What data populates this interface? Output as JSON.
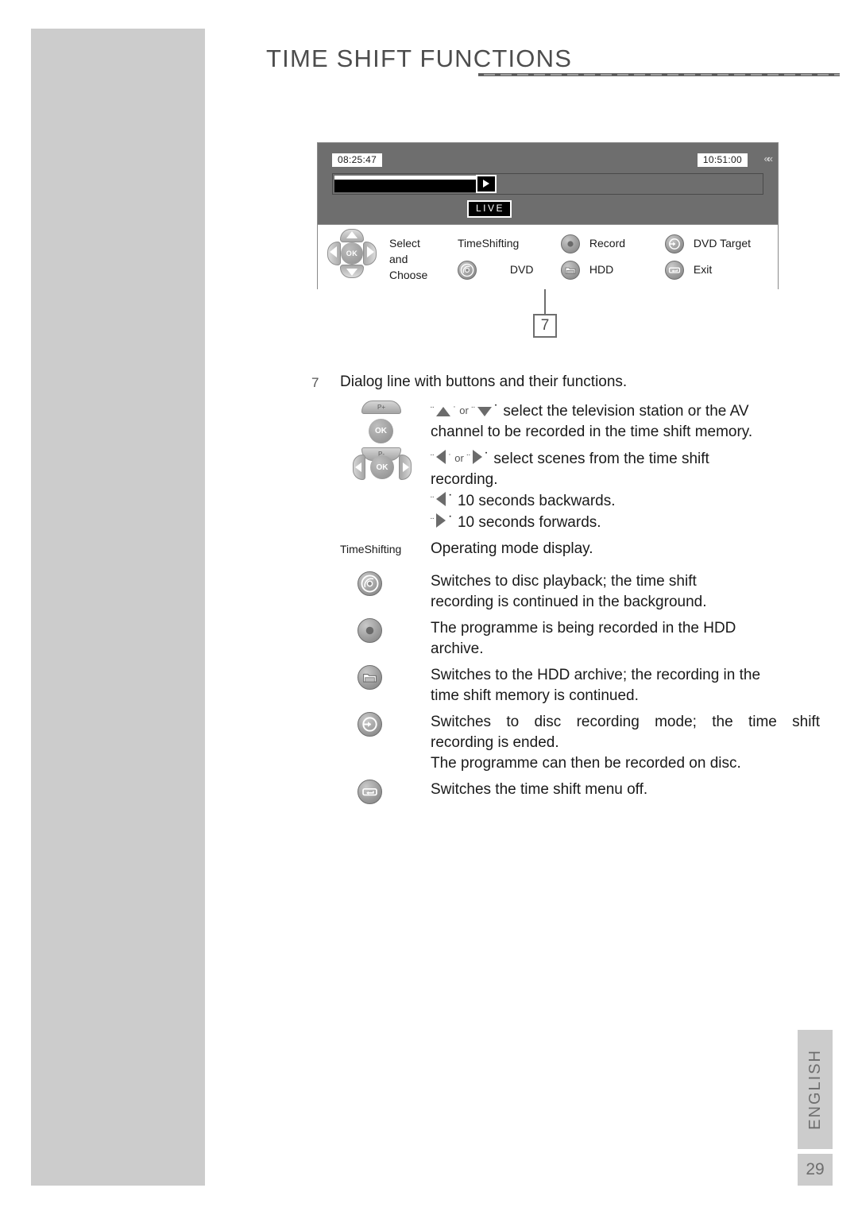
{
  "header": {
    "title": "TIME SHIFT FUNCTIONS",
    "rule": "dashed-rule"
  },
  "osd": {
    "time_start": "08:25:47",
    "time_end": "10:51:00",
    "chevrons": "««",
    "live_badge": "LIVE",
    "progress_percent": 32,
    "dpad": {
      "ok_label": "OK"
    },
    "dialog": {
      "select_line1": "Select",
      "select_line2": "and",
      "select_line3": "Choose",
      "mode_label": "TimeShifting",
      "dvd_label": "DVD",
      "record_label": "Record",
      "hdd_label": "HDD",
      "dvd_target_label": "DVD Target",
      "exit_label": "Exit"
    }
  },
  "callout": {
    "number": "7"
  },
  "body": {
    "lead_num": "7",
    "lead_text": "Dialog line with buttons and their functions.",
    "items": [
      {
        "graphic": "remote-updown",
        "line1_a": "¨",
        "line1_b": "˙ or ¨",
        "line1_c": "˙ select the television station or the AV",
        "line2": "channel to be recorded in the time shift memory."
      },
      {
        "graphic": "remote-leftright",
        "l1_a": "¨",
        "l1_b": "˙ or ¨",
        "l1_c": "˙ select scenes from the time shift",
        "l2": "recording.",
        "l3_a": "¨",
        "l3_b": "˙ 10 seconds backwards.",
        "l4_a": "¨",
        "l4_b": "˙ 10 seconds forwards."
      },
      {
        "graphic": "mode-text",
        "label": "TimeShifting",
        "text": "Operating mode display."
      },
      {
        "graphic": "dvd-icon",
        "line1": "Switches to disc playback; the time shift",
        "line2": "recording is continued in the background."
      },
      {
        "graphic": "record-icon",
        "line1": "The programme is being recorded in the HDD",
        "line2": "archive."
      },
      {
        "graphic": "hdd-icon",
        "line1": "Switches to the HDD archive; the recording in the",
        "line2": "time shift memory is continued."
      },
      {
        "graphic": "dvd-target-icon",
        "line1": "Switches to disc recording mode; the time shift",
        "line2": "recording is ended.",
        "line3": "The programme can then be recorded on disc."
      },
      {
        "graphic": "exit-icon",
        "line1": "Switches the time shift menu off."
      }
    ]
  },
  "footer": {
    "language": "ENGLISH",
    "page_number": "29"
  },
  "colors": {
    "sidebar": "#cccccc",
    "osd_background": "#6e6e6e",
    "rule": "#6a6a6a",
    "heading": "#4d4d4d"
  }
}
